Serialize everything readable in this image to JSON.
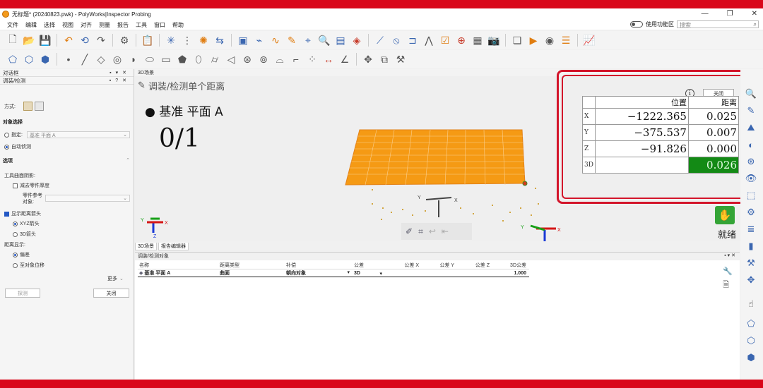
{
  "window": {
    "title": "无标题* (20240823.pwk) - PolyWorks|Inspector Probing",
    "controls": [
      "—",
      "❐",
      "✕"
    ]
  },
  "menu": {
    "items": [
      "文件",
      "编辑",
      "选择",
      "视图",
      "对齐",
      "测量",
      "报告",
      "工具",
      "窗口",
      "帮助"
    ],
    "toggle_label": "使用功能区",
    "search_placeholder": "搜索"
  },
  "left_panel": {
    "dialog_title": "对话框",
    "panel_title": "调装/检测",
    "method_label": "方式:",
    "object_select_heading": "对象选择",
    "specify_label": "指定:",
    "specify_value": "基准 平面 A",
    "auto_detect_label": "自动侦测",
    "options_heading": "选项",
    "tool_surface_label": "工具曲面阴影:",
    "subtract_thickness_label": "减去零件厚度",
    "part_ref_label": "零件参考",
    "object_label": "对象:",
    "show_arrow_label": "显示距离箭头",
    "xyz_arrow_label": "XYZ箭头",
    "arrow_3d_label": "3D箭头",
    "distance_display_label": "距离显示:",
    "deviation_label": "偏差",
    "to_object_label": "至对象位移",
    "more_label": "更多",
    "probe_button": "探测",
    "close_button": "关闭"
  },
  "viewport": {
    "tab_title": "3D场景",
    "probe_heading": "调装/检测单个距离",
    "basis_label": "基准 平面 A",
    "count": "0/1",
    "bottom_tabs": [
      "3D场景",
      "报告编辑器"
    ],
    "ready_label": "就绪",
    "axis_labels": [
      "X",
      "Y",
      "Z"
    ]
  },
  "distance_panel": {
    "close_button": "关闭",
    "info_icon": "i",
    "header": [
      "",
      "位置",
      "距离"
    ],
    "rows": [
      {
        "axis": "X",
        "position": "−1222.365",
        "distance": "0.025"
      },
      {
        "axis": "Y",
        "position": "−375.537",
        "distance": "0.007"
      },
      {
        "axis": "Z",
        "position": "−91.826",
        "distance": "0.000"
      },
      {
        "axis": "3D",
        "position": "",
        "distance": "0.026"
      }
    ],
    "highlight_color": "#138a15"
  },
  "bottom_panel": {
    "title": "调装/检测对象",
    "columns": [
      "名称",
      "距离类型",
      "补偿",
      "公差",
      "公差 X",
      "公差 Y",
      "公差 Z",
      "3D公差"
    ],
    "rows": [
      {
        "name": "基准 平面 A",
        "distance_type": "曲面",
        "compensation": "朝向对象",
        "tolerance": "3D",
        "tol_x": "",
        "tol_y": "",
        "tol_z": "",
        "tol_3d": "1.000"
      }
    ]
  },
  "colors": {
    "accent_red": "#d3152b",
    "surface_orange": "#f59a14",
    "ok_green": "#34a436"
  }
}
